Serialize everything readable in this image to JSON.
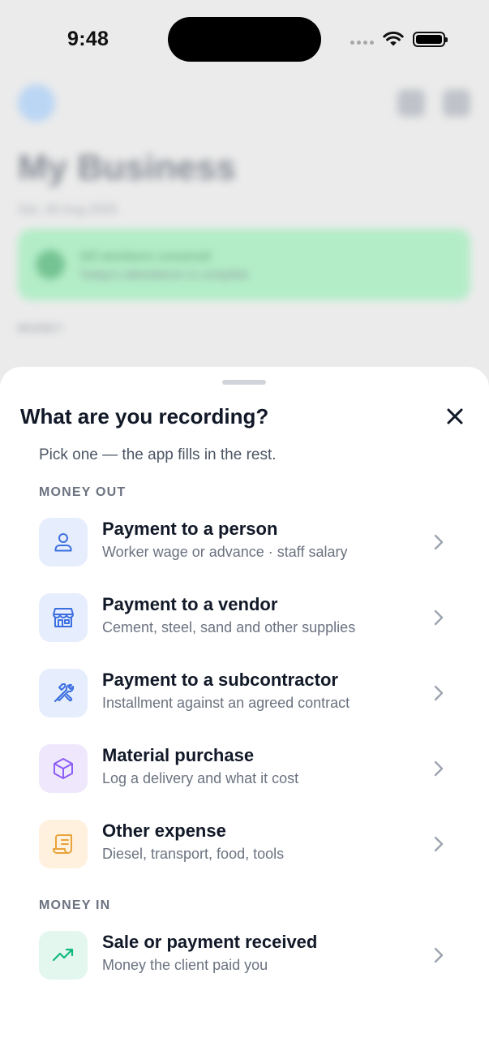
{
  "status_bar": {
    "time": "9:48"
  },
  "background": {
    "title": "My Business",
    "date": "Sat, 30 Aug 2025",
    "banner_title": "All workers covered",
    "banner_desc": "Today's attendance is complete",
    "section": "MONEY"
  },
  "sheet": {
    "title": "What are you recording?",
    "subtitle": "Pick one — the app fills in the rest.",
    "close_icon": "close-icon",
    "sections": [
      {
        "label": "MONEY OUT",
        "options": [
          {
            "title": "Payment to a person",
            "desc": "Worker wage or advance · staff salary",
            "icon": "person-icon",
            "tone": "blue"
          },
          {
            "title": "Payment to a vendor",
            "desc": "Cement, steel, sand and other supplies",
            "icon": "store-icon",
            "tone": "blue"
          },
          {
            "title": "Payment to a subcontractor",
            "desc": "Installment against an agreed contract",
            "icon": "tools-icon",
            "tone": "blue"
          },
          {
            "title": "Material purchase",
            "desc": "Log a delivery and what it cost",
            "icon": "box-icon",
            "tone": "purple"
          },
          {
            "title": "Other expense",
            "desc": "Diesel, transport, food, tools",
            "icon": "receipt-icon",
            "tone": "orange"
          }
        ]
      },
      {
        "label": "MONEY IN",
        "options": [
          {
            "title": "Sale or payment received",
            "desc": "Money the client paid you",
            "icon": "trending-up-icon",
            "tone": "green"
          }
        ]
      }
    ]
  },
  "colors": {
    "blue_icon": "#3b6fe0",
    "purple_icon": "#8b5cf6",
    "orange_icon": "#e8a33a",
    "green_icon": "#10b981"
  }
}
